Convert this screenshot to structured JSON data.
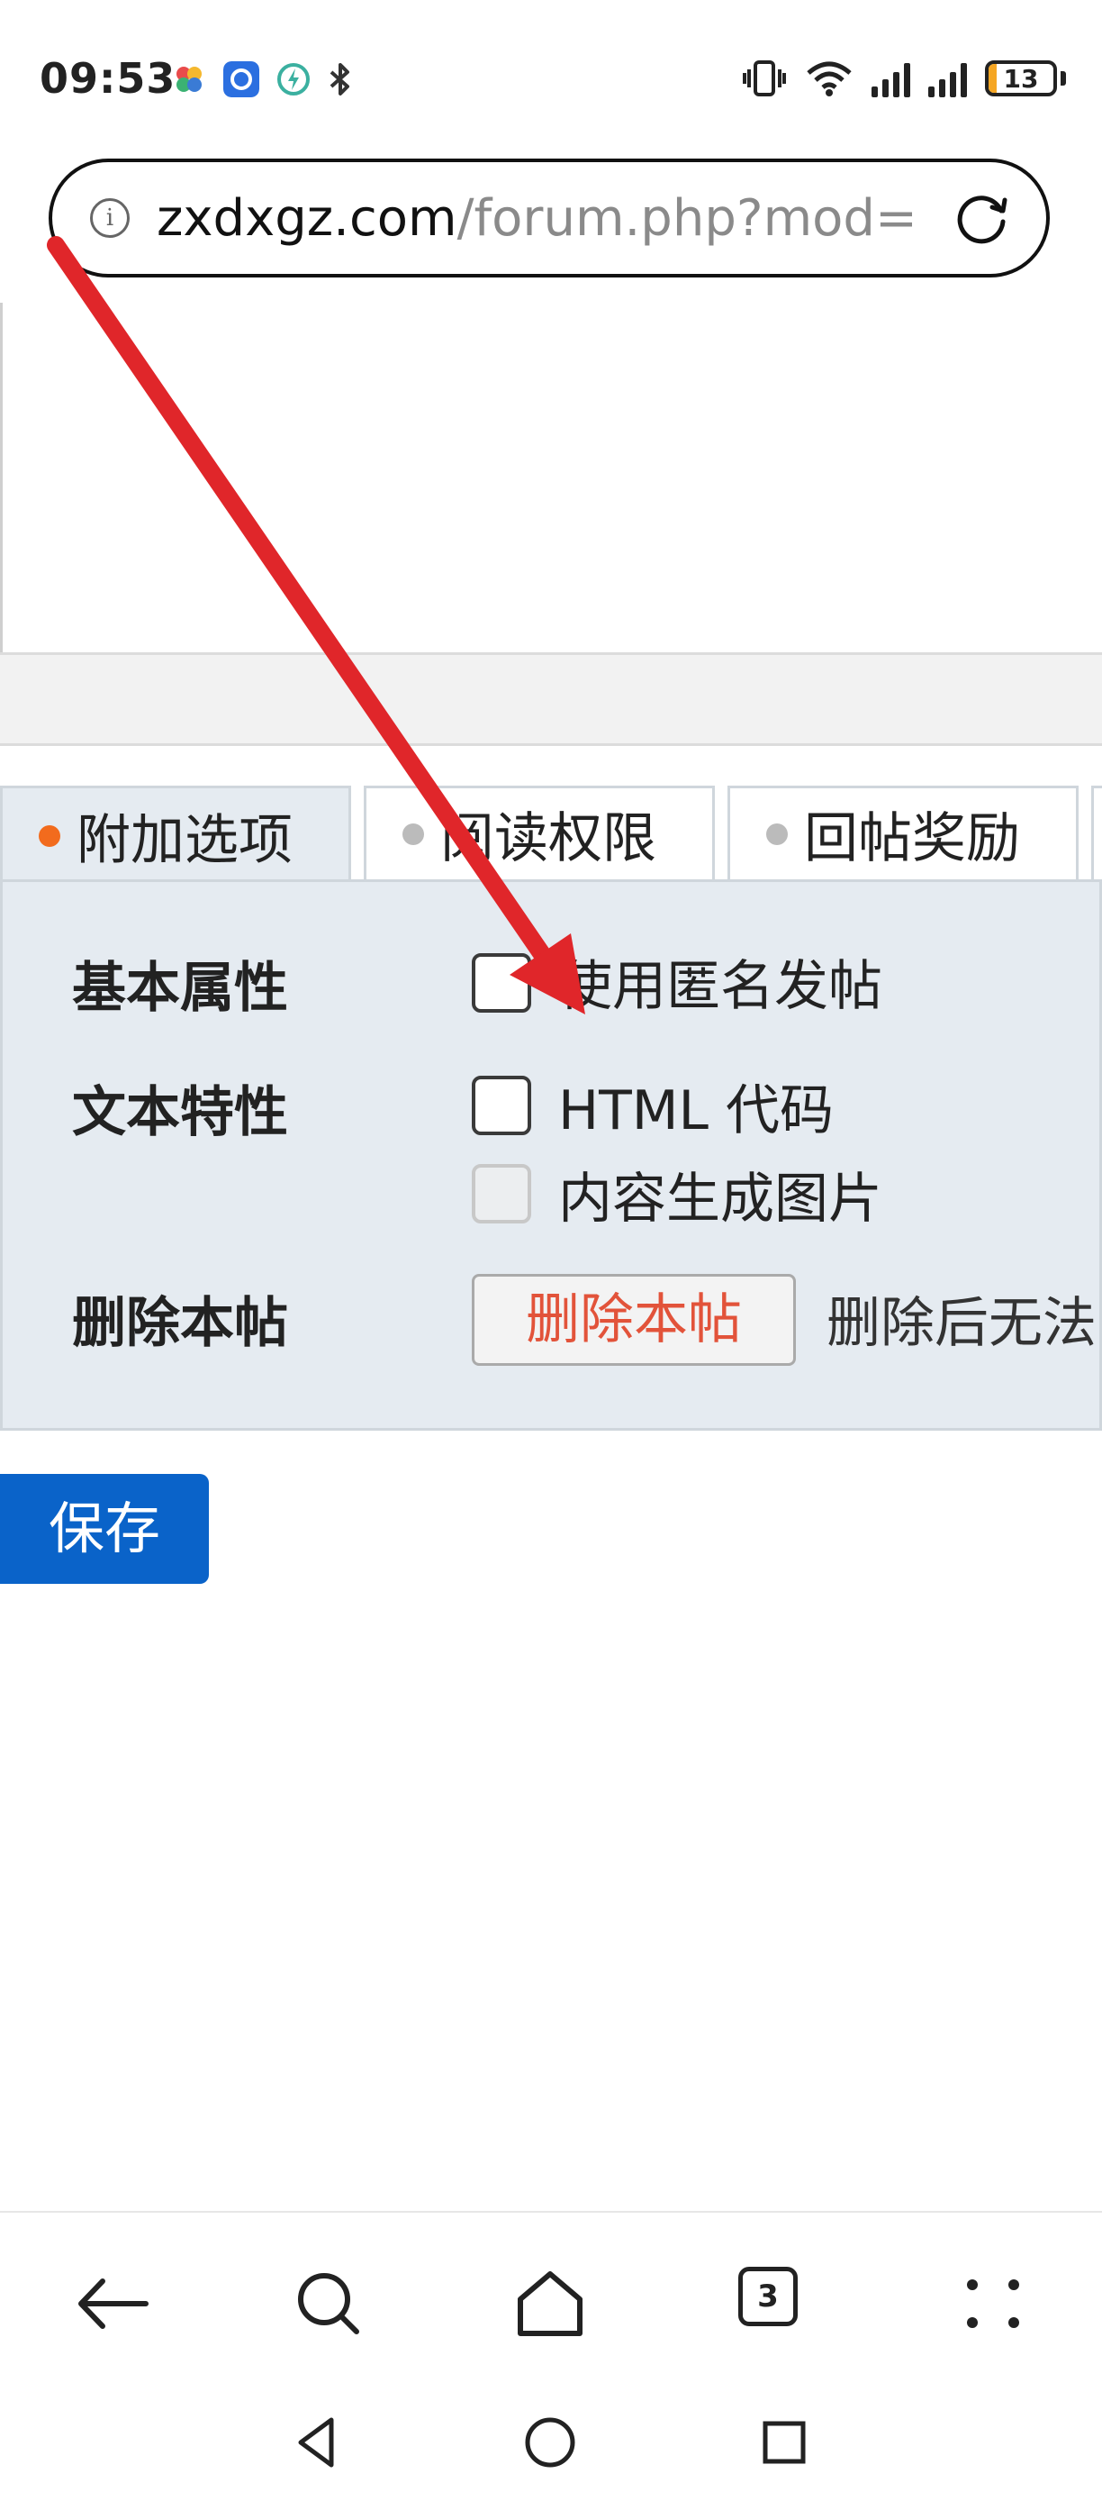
{
  "status_bar": {
    "time": "09:53",
    "battery": "13",
    "battery_level": 0.13,
    "accent_battery": "#f5a623"
  },
  "address_bar": {
    "domain": "zxdxgz.com",
    "path": "/forum.php?mod=",
    "info_icon": "i"
  },
  "tabs": [
    {
      "label": "附加选项",
      "active": true
    },
    {
      "label": "阅读权限",
      "active": false
    },
    {
      "label": "回帖奖励",
      "active": false
    }
  ],
  "options": {
    "basic_label": "基本属性",
    "anonymous_label": "使用匿名发帖",
    "text_label": "文本特性",
    "html_label": "HTML 代码",
    "image_label": "内容生成图片",
    "delete_label": "删除本帖",
    "delete_button": "删除本帖",
    "delete_note": "删除后无法"
  },
  "save_button": "保存",
  "toolbar": {
    "tabs_count": "3",
    "icons": [
      "back-icon",
      "search-icon",
      "home-icon",
      "tabs-icon",
      "menu-icon"
    ]
  },
  "colors": {
    "accent_blue": "#0a63c9",
    "danger": "#e2533a",
    "tab_dot_active": "#f26b1d",
    "annotation_arrow": "#e0262a"
  }
}
